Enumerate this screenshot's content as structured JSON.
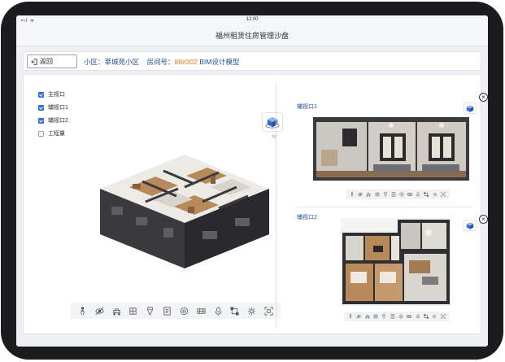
{
  "status_bar": {
    "signal": "•ıl ᯤ",
    "time": "12:00"
  },
  "app": {
    "title": "福州租赁住房管理沙盘"
  },
  "header": {
    "back_label": "返回",
    "community_label": "小区：",
    "community_value": "莘城苑小区",
    "room_label": "房间号：",
    "room_value": "88#302",
    "model_label": "BIM设计模型"
  },
  "layers": [
    {
      "label": "主视口",
      "checked": true
    },
    {
      "label": "辅视口1",
      "checked": true
    },
    {
      "label": "辅视口2",
      "checked": true
    },
    {
      "label": "工程量",
      "checked": false
    }
  ],
  "toolbar_icons": [
    "walk-icon",
    "visibility-icon",
    "roaming-icon",
    "section-icon",
    "measure-icon",
    "properties-icon",
    "settings-circle-icon",
    "elevation-icon",
    "microphone-icon",
    "bounding-box-icon",
    "gear-icon",
    "fullscreen-icon"
  ],
  "viewports": [
    {
      "title": "辅视口1",
      "close": "×"
    },
    {
      "title": "辅视口2",
      "close": "×"
    }
  ],
  "colors": {
    "accent": "#2f6de1",
    "label_blue": "#1f4e9c",
    "highlight_orange": "#e67a2e",
    "wall_dark": "#2f2f33",
    "floor_wood": "#b88a5a"
  }
}
